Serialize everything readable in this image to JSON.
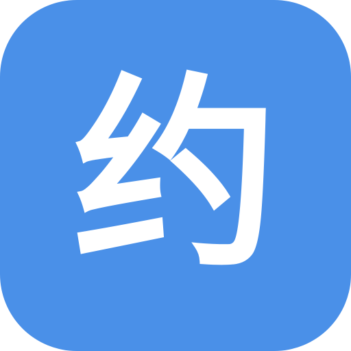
{
  "icon": {
    "glyph": "约",
    "background_color": "#4A90E8",
    "glyph_color": "#FFFFFF"
  }
}
